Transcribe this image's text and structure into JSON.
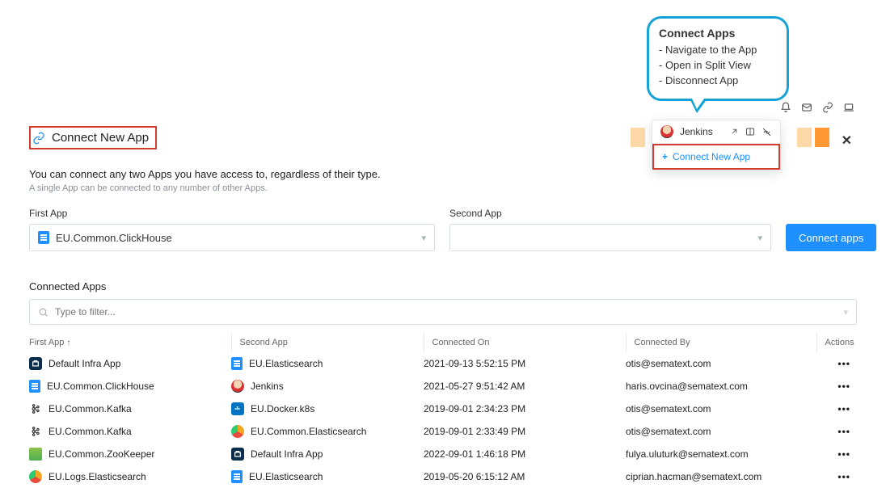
{
  "callout": {
    "title": "Connect Apps",
    "lines": [
      "- Navigate to the App",
      "- Open in Split View",
      "- Disconnect App"
    ]
  },
  "popover": {
    "item_label": "Jenkins",
    "connect_label": "Connect New App"
  },
  "header": {
    "title": "Connect New App"
  },
  "description": {
    "main": "You can connect any two Apps you have access to, regardless of their type.",
    "sub": "A single App can be connected to any number of other Apps."
  },
  "form": {
    "first_label": "First App",
    "second_label": "Second App",
    "first_value": "EU.Common.ClickHouse",
    "connect_button": "Connect apps"
  },
  "connected": {
    "title": "Connected Apps",
    "filter_placeholder": "Type to filter..."
  },
  "columns": {
    "first": "First App",
    "second": "Second App",
    "connected_on": "Connected On",
    "connected_by": "Connected By",
    "actions": "Actions"
  },
  "rows": [
    {
      "first_icon": "infra",
      "first": "Default Infra App",
      "second_icon": "doc",
      "second": "EU.Elasticsearch",
      "on": "2021-09-13 5:52:15 PM",
      "by": "otis@sematext.com"
    },
    {
      "first_icon": "doc",
      "first": "EU.Common.ClickHouse",
      "second_icon": "jenkins",
      "second": "Jenkins",
      "on": "2021-05-27 9:51:42 AM",
      "by": "haris.ovcina@sematext.com"
    },
    {
      "first_icon": "kafka",
      "first": "EU.Common.Kafka",
      "second_icon": "docker",
      "second": "EU.Docker.k8s",
      "on": "2019-09-01 2:34:23 PM",
      "by": "otis@sematext.com"
    },
    {
      "first_icon": "kafka",
      "first": "EU.Common.Kafka",
      "second_icon": "es",
      "second": "EU.Common.Elasticsearch",
      "on": "2019-09-01 2:33:49 PM",
      "by": "otis@sematext.com"
    },
    {
      "first_icon": "zk",
      "first": "EU.Common.ZooKeeper",
      "second_icon": "infra",
      "second": "Default Infra App",
      "on": "2022-09-01 1:46:18 PM",
      "by": "fulya.uluturk@sematext.com"
    },
    {
      "first_icon": "es",
      "first": "EU.Logs.Elasticsearch",
      "second_icon": "doc",
      "second": "EU.Elasticsearch",
      "on": "2019-05-20 6:15:12 AM",
      "by": "ciprian.hacman@sematext.com"
    }
  ]
}
